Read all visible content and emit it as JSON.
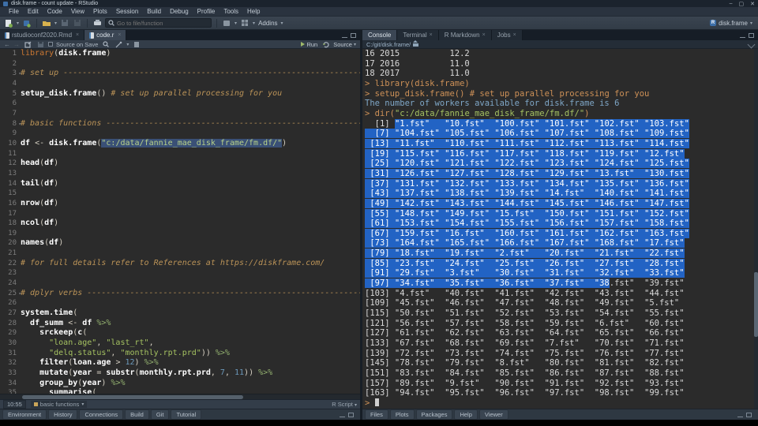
{
  "titlebar": {
    "title": "disk.frame - count update - RStudio",
    "controls": {
      "minimize": "–",
      "maximize": "▢",
      "close": "✕"
    }
  },
  "menubar": {
    "items": [
      "File",
      "Edit",
      "Code",
      "View",
      "Plots",
      "Session",
      "Build",
      "Debug",
      "Profile",
      "Tools",
      "Help"
    ]
  },
  "toolbar": {
    "goto_placeholder": "Go to file/function",
    "addins_label": "Addins",
    "project_label": "disk.frame"
  },
  "editor": {
    "tabs": [
      {
        "label": "rstudioconf2020.Rmd",
        "active": false
      },
      {
        "label": "code.r",
        "active": true
      }
    ],
    "toolbar": {
      "source_on_save": "Source on Save",
      "run_label": "Run",
      "source_label": "Source"
    },
    "status": {
      "position": "10:55",
      "section": "basic functions",
      "file_type": "R Script"
    },
    "code_lines": [
      {
        "n": 1,
        "segs": [
          [
            "kw",
            "library"
          ],
          [
            "p",
            "("
          ],
          [
            "b",
            "disk.frame"
          ],
          [
            "p",
            ")"
          ]
        ]
      },
      {
        "n": 2,
        "segs": []
      },
      {
        "n": 3,
        "fold": true,
        "segs": [
          [
            "c",
            "# set up ------------------------------------------------------------------"
          ]
        ]
      },
      {
        "n": 4,
        "segs": []
      },
      {
        "n": 5,
        "segs": [
          [
            "b",
            "setup_disk.frame"
          ],
          [
            "p",
            "() "
          ],
          [
            "c",
            "# set up parallel processing for you"
          ]
        ]
      },
      {
        "n": 6,
        "segs": []
      },
      {
        "n": 7,
        "segs": []
      },
      {
        "n": 8,
        "fold": true,
        "segs": [
          [
            "c",
            "# basic functions ---------------------------------------------------------"
          ]
        ]
      },
      {
        "n": 9,
        "segs": []
      },
      {
        "n": 10,
        "segs": [
          [
            "b",
            "df"
          ],
          [
            "p",
            " <- "
          ],
          [
            "b",
            "disk.frame"
          ],
          [
            "p",
            "("
          ],
          [
            "ssel",
            "\"c:/data/fannie_mae_disk_frame/fm.df/\""
          ],
          [
            "p",
            ")"
          ]
        ]
      },
      {
        "n": 11,
        "segs": []
      },
      {
        "n": 12,
        "segs": [
          [
            "b",
            "head"
          ],
          [
            "p",
            "("
          ],
          [
            "b",
            "df"
          ],
          [
            "p",
            ")"
          ]
        ]
      },
      {
        "n": 13,
        "segs": []
      },
      {
        "n": 14,
        "segs": [
          [
            "b",
            "tail"
          ],
          [
            "p",
            "("
          ],
          [
            "b",
            "df"
          ],
          [
            "p",
            ")"
          ]
        ]
      },
      {
        "n": 15,
        "segs": []
      },
      {
        "n": 16,
        "segs": [
          [
            "b",
            "nrow"
          ],
          [
            "p",
            "("
          ],
          [
            "b",
            "df"
          ],
          [
            "p",
            ")"
          ]
        ]
      },
      {
        "n": 17,
        "segs": []
      },
      {
        "n": 18,
        "segs": [
          [
            "b",
            "ncol"
          ],
          [
            "p",
            "("
          ],
          [
            "b",
            "df"
          ],
          [
            "p",
            ")"
          ]
        ]
      },
      {
        "n": 19,
        "segs": []
      },
      {
        "n": 20,
        "segs": [
          [
            "b",
            "names"
          ],
          [
            "p",
            "("
          ],
          [
            "b",
            "df"
          ],
          [
            "p",
            ")"
          ]
        ]
      },
      {
        "n": 21,
        "segs": []
      },
      {
        "n": 22,
        "segs": [
          [
            "c",
            "# for full details refer to References at https://diskframe.com/"
          ]
        ]
      },
      {
        "n": 23,
        "segs": []
      },
      {
        "n": 24,
        "segs": []
      },
      {
        "n": 25,
        "fold": true,
        "segs": [
          [
            "c",
            "# dplyr verbs -------------------------------------------------------------"
          ]
        ]
      },
      {
        "n": 26,
        "segs": []
      },
      {
        "n": 27,
        "segs": [
          [
            "b",
            "system.time"
          ],
          [
            "p",
            "("
          ]
        ]
      },
      {
        "n": 28,
        "segs": [
          [
            "p",
            "  "
          ],
          [
            "b",
            "df_summ"
          ],
          [
            "p",
            " <- "
          ],
          [
            "b",
            "df"
          ],
          [
            "pipe",
            " %>%"
          ]
        ]
      },
      {
        "n": 29,
        "segs": [
          [
            "p",
            "    "
          ],
          [
            "b",
            "srckeep"
          ],
          [
            "p",
            "("
          ],
          [
            "b",
            "c"
          ],
          [
            "p",
            "("
          ]
        ]
      },
      {
        "n": 30,
        "segs": [
          [
            "p",
            "      "
          ],
          [
            "s",
            "\"loan.age\""
          ],
          [
            "p",
            ", "
          ],
          [
            "s",
            "\"last_rt\""
          ],
          [
            "p",
            ","
          ]
        ]
      },
      {
        "n": 31,
        "segs": [
          [
            "p",
            "      "
          ],
          [
            "s",
            "\"delq.status\""
          ],
          [
            "p",
            ", "
          ],
          [
            "s",
            "\"monthly.rpt.prd\""
          ],
          [
            "p",
            ")) "
          ],
          [
            "pipe",
            "%>%"
          ]
        ]
      },
      {
        "n": 32,
        "segs": [
          [
            "p",
            "    "
          ],
          [
            "b",
            "filter"
          ],
          [
            "p",
            "("
          ],
          [
            "b",
            "loan.age"
          ],
          [
            "p",
            " > "
          ],
          [
            "n",
            "12"
          ],
          [
            "p",
            ") "
          ],
          [
            "pipe",
            "%>%"
          ]
        ]
      },
      {
        "n": 33,
        "segs": [
          [
            "p",
            "    "
          ],
          [
            "b",
            "mutate"
          ],
          [
            "p",
            "("
          ],
          [
            "b",
            "year"
          ],
          [
            "p",
            " = "
          ],
          [
            "b",
            "substr"
          ],
          [
            "p",
            "("
          ],
          [
            "b",
            "monthly.rpt.prd"
          ],
          [
            "p",
            ", "
          ],
          [
            "n",
            "7"
          ],
          [
            "p",
            ", "
          ],
          [
            "n",
            "11"
          ],
          [
            "p",
            ")) "
          ],
          [
            "pipe",
            "%>%"
          ]
        ]
      },
      {
        "n": 34,
        "segs": [
          [
            "p",
            "    "
          ],
          [
            "b",
            "group_by"
          ],
          [
            "p",
            "("
          ],
          [
            "b",
            "year"
          ],
          [
            "p",
            ") "
          ],
          [
            "pipe",
            "%>%"
          ]
        ]
      },
      {
        "n": 35,
        "segs": [
          [
            "p",
            "      "
          ],
          [
            "b",
            "summarise"
          ],
          [
            "p",
            "("
          ]
        ]
      }
    ]
  },
  "console": {
    "tabs": [
      {
        "label": "Console",
        "active": true,
        "closable": false
      },
      {
        "label": "Terminal",
        "active": false,
        "closable": true
      },
      {
        "label": "R Markdown",
        "active": false,
        "closable": true
      },
      {
        "label": "Jobs",
        "active": false,
        "closable": true
      }
    ],
    "path": "C:/git/disk.frame/",
    "pre_lines": [
      [
        [
          "out",
          "16 2015          12.2"
        ]
      ],
      [
        [
          "out",
          "17 2016          11.0"
        ]
      ],
      [
        [
          "out",
          "18 2017          11.0"
        ]
      ],
      [
        [
          "cmd",
          "> library(disk.frame)"
        ]
      ],
      [
        [
          "cmd",
          "> setup_disk.frame() "
        ],
        [
          "cmdc",
          "# set up parallel processing for you"
        ]
      ],
      [
        [
          "msg",
          "The number of workers available for disk.frame is 6"
        ]
      ],
      [
        [
          "cmd",
          "> dir("
        ],
        [
          "str",
          "\"c:/data/fannie_mae_disk_frame/fm.df/\""
        ],
        [
          "cmd",
          ")"
        ]
      ]
    ],
    "dir_rows": [
      {
        "t": "  [1] \"1.fst\"   \"10.fst\"  \"100.fst\" \"101.fst\" \"102.fst\" \"103.fst\"",
        "sel": [
          6,
          -1
        ]
      },
      {
        "t": "  [7] \"104.fst\" \"105.fst\" \"106.fst\" \"107.fst\" \"108.fst\" \"109.fst\"",
        "sel": [
          0,
          -1
        ]
      },
      {
        "t": " [13] \"11.fst\"  \"110.fst\" \"111.fst\" \"112.fst\" \"113.fst\" \"114.fst\"",
        "sel": [
          0,
          -1
        ]
      },
      {
        "t": " [19] \"115.fst\" \"116.fst\" \"117.fst\" \"118.fst\" \"119.fst\" \"12.fst\"",
        "sel": [
          0,
          -1
        ]
      },
      {
        "t": " [25] \"120.fst\" \"121.fst\" \"122.fst\" \"123.fst\" \"124.fst\" \"125.fst\"",
        "sel": [
          0,
          -1
        ]
      },
      {
        "t": " [31] \"126.fst\" \"127.fst\" \"128.fst\" \"129.fst\" \"13.fst\"  \"130.fst\"",
        "sel": [
          0,
          -1
        ]
      },
      {
        "t": " [37] \"131.fst\" \"132.fst\" \"133.fst\" \"134.fst\" \"135.fst\" \"136.fst\"",
        "sel": [
          0,
          -1
        ]
      },
      {
        "t": " [43] \"137.fst\" \"138.fst\" \"139.fst\" \"14.fst\"  \"140.fst\" \"141.fst\"",
        "sel": [
          0,
          -1
        ]
      },
      {
        "t": " [49] \"142.fst\" \"143.fst\" \"144.fst\" \"145.fst\" \"146.fst\" \"147.fst\"",
        "sel": [
          0,
          -1
        ]
      },
      {
        "t": " [55] \"148.fst\" \"149.fst\" \"15.fst\"  \"150.fst\" \"151.fst\" \"152.fst\"",
        "sel": [
          0,
          -1
        ]
      },
      {
        "t": " [61] \"153.fst\" \"154.fst\" \"155.fst\" \"156.fst\" \"157.fst\" \"158.fst\"",
        "sel": [
          0,
          -1
        ]
      },
      {
        "t": " [67] \"159.fst\" \"16.fst\"  \"160.fst\" \"161.fst\" \"162.fst\" \"163.fst\"",
        "sel": [
          0,
          -1
        ]
      },
      {
        "t": " [73] \"164.fst\" \"165.fst\" \"166.fst\" \"167.fst\" \"168.fst\" \"17.fst\"",
        "sel": [
          0,
          -1
        ]
      },
      {
        "t": " [79] \"18.fst\"  \"19.fst\"  \"2.fst\"   \"20.fst\"  \"21.fst\"  \"22.fst\"",
        "sel": [
          0,
          -1
        ]
      },
      {
        "t": " [85] \"23.fst\"  \"24.fst\"  \"25.fst\"  \"26.fst\"  \"27.fst\"  \"28.fst\"",
        "sel": [
          0,
          -1
        ]
      },
      {
        "t": " [91] \"29.fst\"  \"3.fst\"   \"30.fst\"  \"31.fst\"  \"32.fst\"  \"33.fst\"",
        "sel": [
          0,
          -1
        ]
      },
      {
        "t": " [97] \"34.fst\"  \"35.fst\"  \"36.fst\"  \"37.fst\"  \"38.fst\"  \"39.fst\"",
        "sel": [
          0,
          49
        ]
      },
      {
        "t": "[103] \"4.fst\"   \"40.fst\"  \"41.fst\"  \"42.fst\"  \"43.fst\"  \"44.fst\"",
        "sel": null
      },
      {
        "t": "[109] \"45.fst\"  \"46.fst\"  \"47.fst\"  \"48.fst\"  \"49.fst\"  \"5.fst\"",
        "sel": null
      },
      {
        "t": "[115] \"50.fst\"  \"51.fst\"  \"52.fst\"  \"53.fst\"  \"54.fst\"  \"55.fst\"",
        "sel": null
      },
      {
        "t": "[121] \"56.fst\"  \"57.fst\"  \"58.fst\"  \"59.fst\"  \"6.fst\"   \"60.fst\"",
        "sel": null
      },
      {
        "t": "[127] \"61.fst\"  \"62.fst\"  \"63.fst\"  \"64.fst\"  \"65.fst\"  \"66.fst\"",
        "sel": null
      },
      {
        "t": "[133] \"67.fst\"  \"68.fst\"  \"69.fst\"  \"7.fst\"   \"70.fst\"  \"71.fst\"",
        "sel": null
      },
      {
        "t": "[139] \"72.fst\"  \"73.fst\"  \"74.fst\"  \"75.fst\"  \"76.fst\"  \"77.fst\"",
        "sel": null
      },
      {
        "t": "[145] \"78.fst\"  \"79.fst\"  \"8.fst\"   \"80.fst\"  \"81.fst\"  \"82.fst\"",
        "sel": null
      },
      {
        "t": "[151] \"83.fst\"  \"84.fst\"  \"85.fst\"  \"86.fst\"  \"87.fst\"  \"88.fst\"",
        "sel": null
      },
      {
        "t": "[157] \"89.fst\"  \"9.fst\"   \"90.fst\"  \"91.fst\"  \"92.fst\"  \"93.fst\"",
        "sel": null
      },
      {
        "t": "[163] \"94.fst\"  \"95.fst\"  \"96.fst\"  \"97.fst\"  \"98.fst\"  \"99.fst\"",
        "sel": null
      }
    ],
    "prompt": "> "
  },
  "bottom_left_tabs": [
    "Environment",
    "History",
    "Connections",
    "Build",
    "Git",
    "Tutorial"
  ],
  "bottom_right_tabs": [
    "Files",
    "Plots",
    "Packages",
    "Help",
    "Viewer"
  ],
  "colors": {
    "selection_blue": "#2263c4",
    "editor_selection": "#3a5076",
    "comment": "#bc9458",
    "keyword": "#cc7833",
    "string": "#a5c261",
    "number": "#6c99bb",
    "command": "#ce9157",
    "message": "#7fa7c7"
  }
}
